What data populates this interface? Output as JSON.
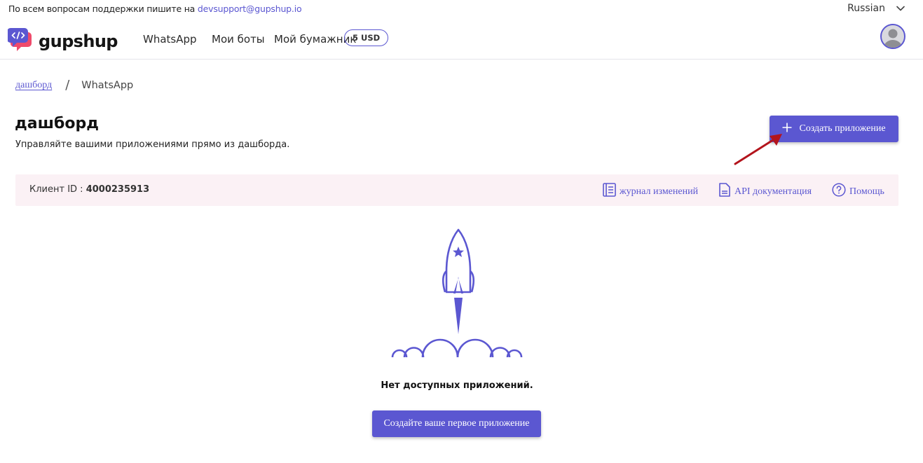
{
  "support": {
    "text": "По всем вопросам поддержки пишите на",
    "email": "devsupport@gupshup.io"
  },
  "language": {
    "selected": "Russian",
    "icon": "chevron-down-icon"
  },
  "brand": {
    "name": "gupshup",
    "icon": "code-chat-bubble-logo"
  },
  "nav": {
    "items": [
      {
        "label": "WhatsApp"
      },
      {
        "label": "Мои боты"
      },
      {
        "label": "Мой бумажник"
      }
    ],
    "wallet_balance": "5 USD"
  },
  "user": {
    "icon": "user-avatar-icon"
  },
  "breadcrumb": {
    "root": "дашборд",
    "separator": "/",
    "current": "WhatsApp"
  },
  "page": {
    "title": "дашборд",
    "subtitle": "Управляйте вашими приложениями прямо из дашборда.",
    "create_button": "Создать приложение"
  },
  "info_bar": {
    "client_label": "Клиент ID :",
    "client_id": "4000235913",
    "links": [
      {
        "label": "журнал изменений",
        "icon": "journal-icon"
      },
      {
        "label": "API документация",
        "icon": "document-icon"
      },
      {
        "label": "Помощь",
        "icon": "help-circle-icon"
      }
    ]
  },
  "empty_state": {
    "illustration": "rocket-launch-icon",
    "text": "Нет доступных приложений.",
    "button": "Создайте ваше первое приложение"
  },
  "colors": {
    "accent": "#5b57d1",
    "info_bar_bg": "#fbf1f5",
    "annotation_arrow": "#b3141c"
  }
}
